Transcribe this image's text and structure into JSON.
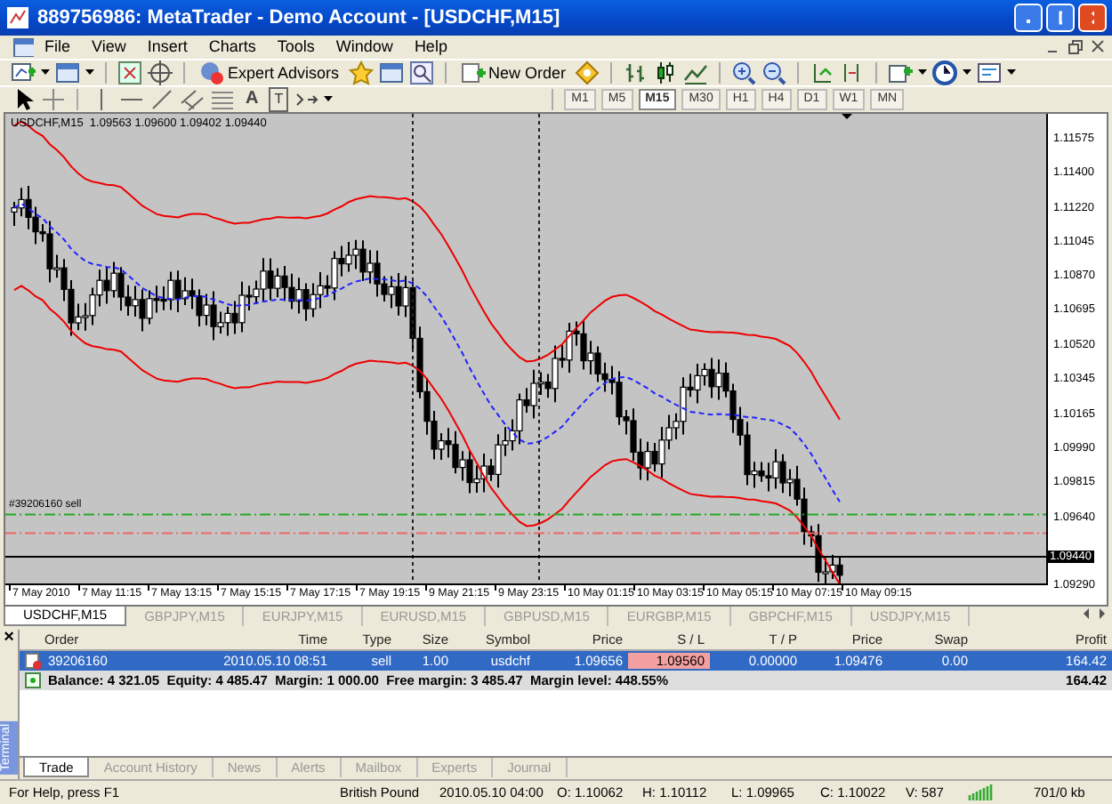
{
  "window": {
    "title": "889756986: MetaTrader - Demo Account - [USDCHF,M15]"
  },
  "menu": [
    "File",
    "View",
    "Insert",
    "Charts",
    "Tools",
    "Window",
    "Help"
  ],
  "toolbar": {
    "expert_advisors": "Expert Advisors",
    "new_order": "New Order",
    "text_tool": "A",
    "label_tool": "T"
  },
  "timeframes": [
    {
      "label": "M1",
      "selected": false
    },
    {
      "label": "M5",
      "selected": false
    },
    {
      "label": "M15",
      "selected": true
    },
    {
      "label": "M30",
      "selected": false
    },
    {
      "label": "H1",
      "selected": false
    },
    {
      "label": "H4",
      "selected": false
    },
    {
      "label": "D1",
      "selected": false
    },
    {
      "label": "W1",
      "selected": false
    },
    {
      "label": "MN",
      "selected": false
    }
  ],
  "chart": {
    "info": "USDCHF,M15  1.09563 1.09600 1.09402 1.09440",
    "order_label": "#39206160 sell",
    "current_price": "1.09440",
    "price_labels": [
      "1.11575",
      "1.11400",
      "1.11220",
      "1.11045",
      "1.10870",
      "1.10695",
      "1.10520",
      "1.10345",
      "1.10165",
      "1.09990",
      "1.09815",
      "1.09640",
      "1.09290"
    ],
    "time_labels": [
      "7 May 2010",
      "7 May 11:15",
      "7 May 13:15",
      "7 May 15:15",
      "7 May 17:15",
      "7 May 19:15",
      "9 May 21:15",
      "9 May 23:15",
      "10 May 01:15",
      "10 May 03:15",
      "10 May 05:15",
      "10 May 07:15",
      "10 May 09:15"
    ]
  },
  "chart_tabs": [
    {
      "label": "USDCHF,M15",
      "selected": true
    },
    {
      "label": "GBPJPY,M15",
      "selected": false
    },
    {
      "label": "EURJPY,M15",
      "selected": false
    },
    {
      "label": "EURUSD,M15",
      "selected": false
    },
    {
      "label": "GBPUSD,M15",
      "selected": false
    },
    {
      "label": "EURGBP,M15",
      "selected": false
    },
    {
      "label": "GBPCHF,M15",
      "selected": false
    },
    {
      "label": "USDJPY,M15",
      "selected": false
    }
  ],
  "terminal": {
    "title": "Terminal",
    "close": "×",
    "columns": [
      "Order",
      "Time",
      "Type",
      "Size",
      "Symbol",
      "Price",
      "S / L",
      "T / P",
      "Price",
      "Swap",
      "Profit"
    ],
    "rows": [
      {
        "selected": true,
        "cells": [
          "39206160",
          "2010.05.10 08:51",
          "sell",
          "1.00",
          "usdchf",
          "1.09656",
          "1.09560",
          "0.00000",
          "1.09476",
          "0.00",
          "164.42"
        ]
      }
    ],
    "summary": "Balance: 4 321.05  Equity: 4 485.47  Margin: 1 000.00  Free margin: 3 485.47  Margin level: 448.55%",
    "summary_profit": "164.42",
    "tabs": [
      {
        "label": "Trade",
        "selected": true
      },
      {
        "label": "Account History",
        "selected": false
      },
      {
        "label": "News",
        "selected": false
      },
      {
        "label": "Alerts",
        "selected": false
      },
      {
        "label": "Mailbox",
        "selected": false
      },
      {
        "label": "Experts",
        "selected": false
      },
      {
        "label": "Journal",
        "selected": false
      }
    ]
  },
  "status_bar": [
    "For Help, press F1",
    "British Pound",
    "2010.05.10 04:00",
    "O: 1.10062",
    "H: 1.10112",
    "L: 1.09965",
    "C: 1.10022",
    "V: 587",
    "701/0 kb"
  ]
}
